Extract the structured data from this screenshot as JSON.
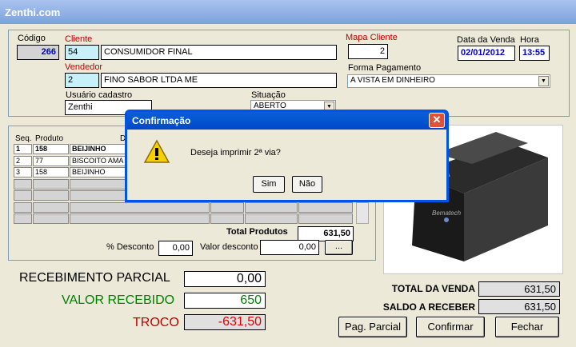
{
  "window": {
    "title": "Zenthi.com"
  },
  "header": {
    "codigo_label": "Código",
    "codigo_value": "266",
    "cliente_label": "Cliente",
    "cliente_id": "54",
    "cliente_name": "CONSUMIDOR FINAL",
    "vendedor_label": "Vendedor",
    "vendedor_id": "2",
    "vendedor_name": "FINO SABOR LTDA ME",
    "usuario_label": "Usuário cadastro",
    "usuario_value": "Zenthi",
    "situacao_label": "Situação",
    "situacao_value": "ABERTO",
    "mapa_label": "Mapa Cliente",
    "mapa_value": "2",
    "data_label": "Data da Venda",
    "data_value": "02/01/2012",
    "hora_label": "Hora",
    "hora_value": "13:55",
    "forma_label": "Forma Pagamento",
    "forma_value": "A VISTA EM DINHEIRO"
  },
  "items": {
    "col_seq": "Seq.",
    "col_produto": "Produto",
    "col_desc": "D",
    "rows": [
      {
        "seq": "1",
        "cod": "158",
        "desc": "BEIJINHO"
      },
      {
        "seq": "2",
        "cod": "77",
        "desc": "BISCOITO AMA"
      },
      {
        "seq": "3",
        "cod": "158",
        "desc": "BEIJINHO"
      }
    ],
    "total_label": "Total Produtos",
    "total_value": "631,50",
    "desconto_pct_label": "% Desconto",
    "desconto_pct_value": "0,00",
    "valor_desconto_label": "Valor desconto",
    "valor_desconto_value": "0,00",
    "ellipsis_label": "..."
  },
  "payment": {
    "parcial_label": "RECEBIMENTO PARCIAL",
    "parcial_value": "0,00",
    "recebido_label": "VALOR RECEBIDO",
    "recebido_value": "650",
    "troco_label": "TROCO",
    "troco_value": "-631,50"
  },
  "summary": {
    "total_venda_label": "TOTAL DA VENDA",
    "total_venda_value": "631,50",
    "saldo_label": "SALDO A RECEBER",
    "saldo_value": "631,50"
  },
  "buttons": {
    "pag_parcial": "Pag. Parcial",
    "confirmar": "Confirmar",
    "fechar": "Fechar"
  },
  "dialog": {
    "title": "Confirmação",
    "message": "Deseja  imprimir 2ª via?",
    "yes": "Sim",
    "no": "Não",
    "icon": "warning-icon"
  },
  "printer": {
    "brand": "Bematech"
  },
  "colors": {
    "titlebar": "#0054e3",
    "label_red": "#c00000",
    "value_green": "#008000"
  }
}
